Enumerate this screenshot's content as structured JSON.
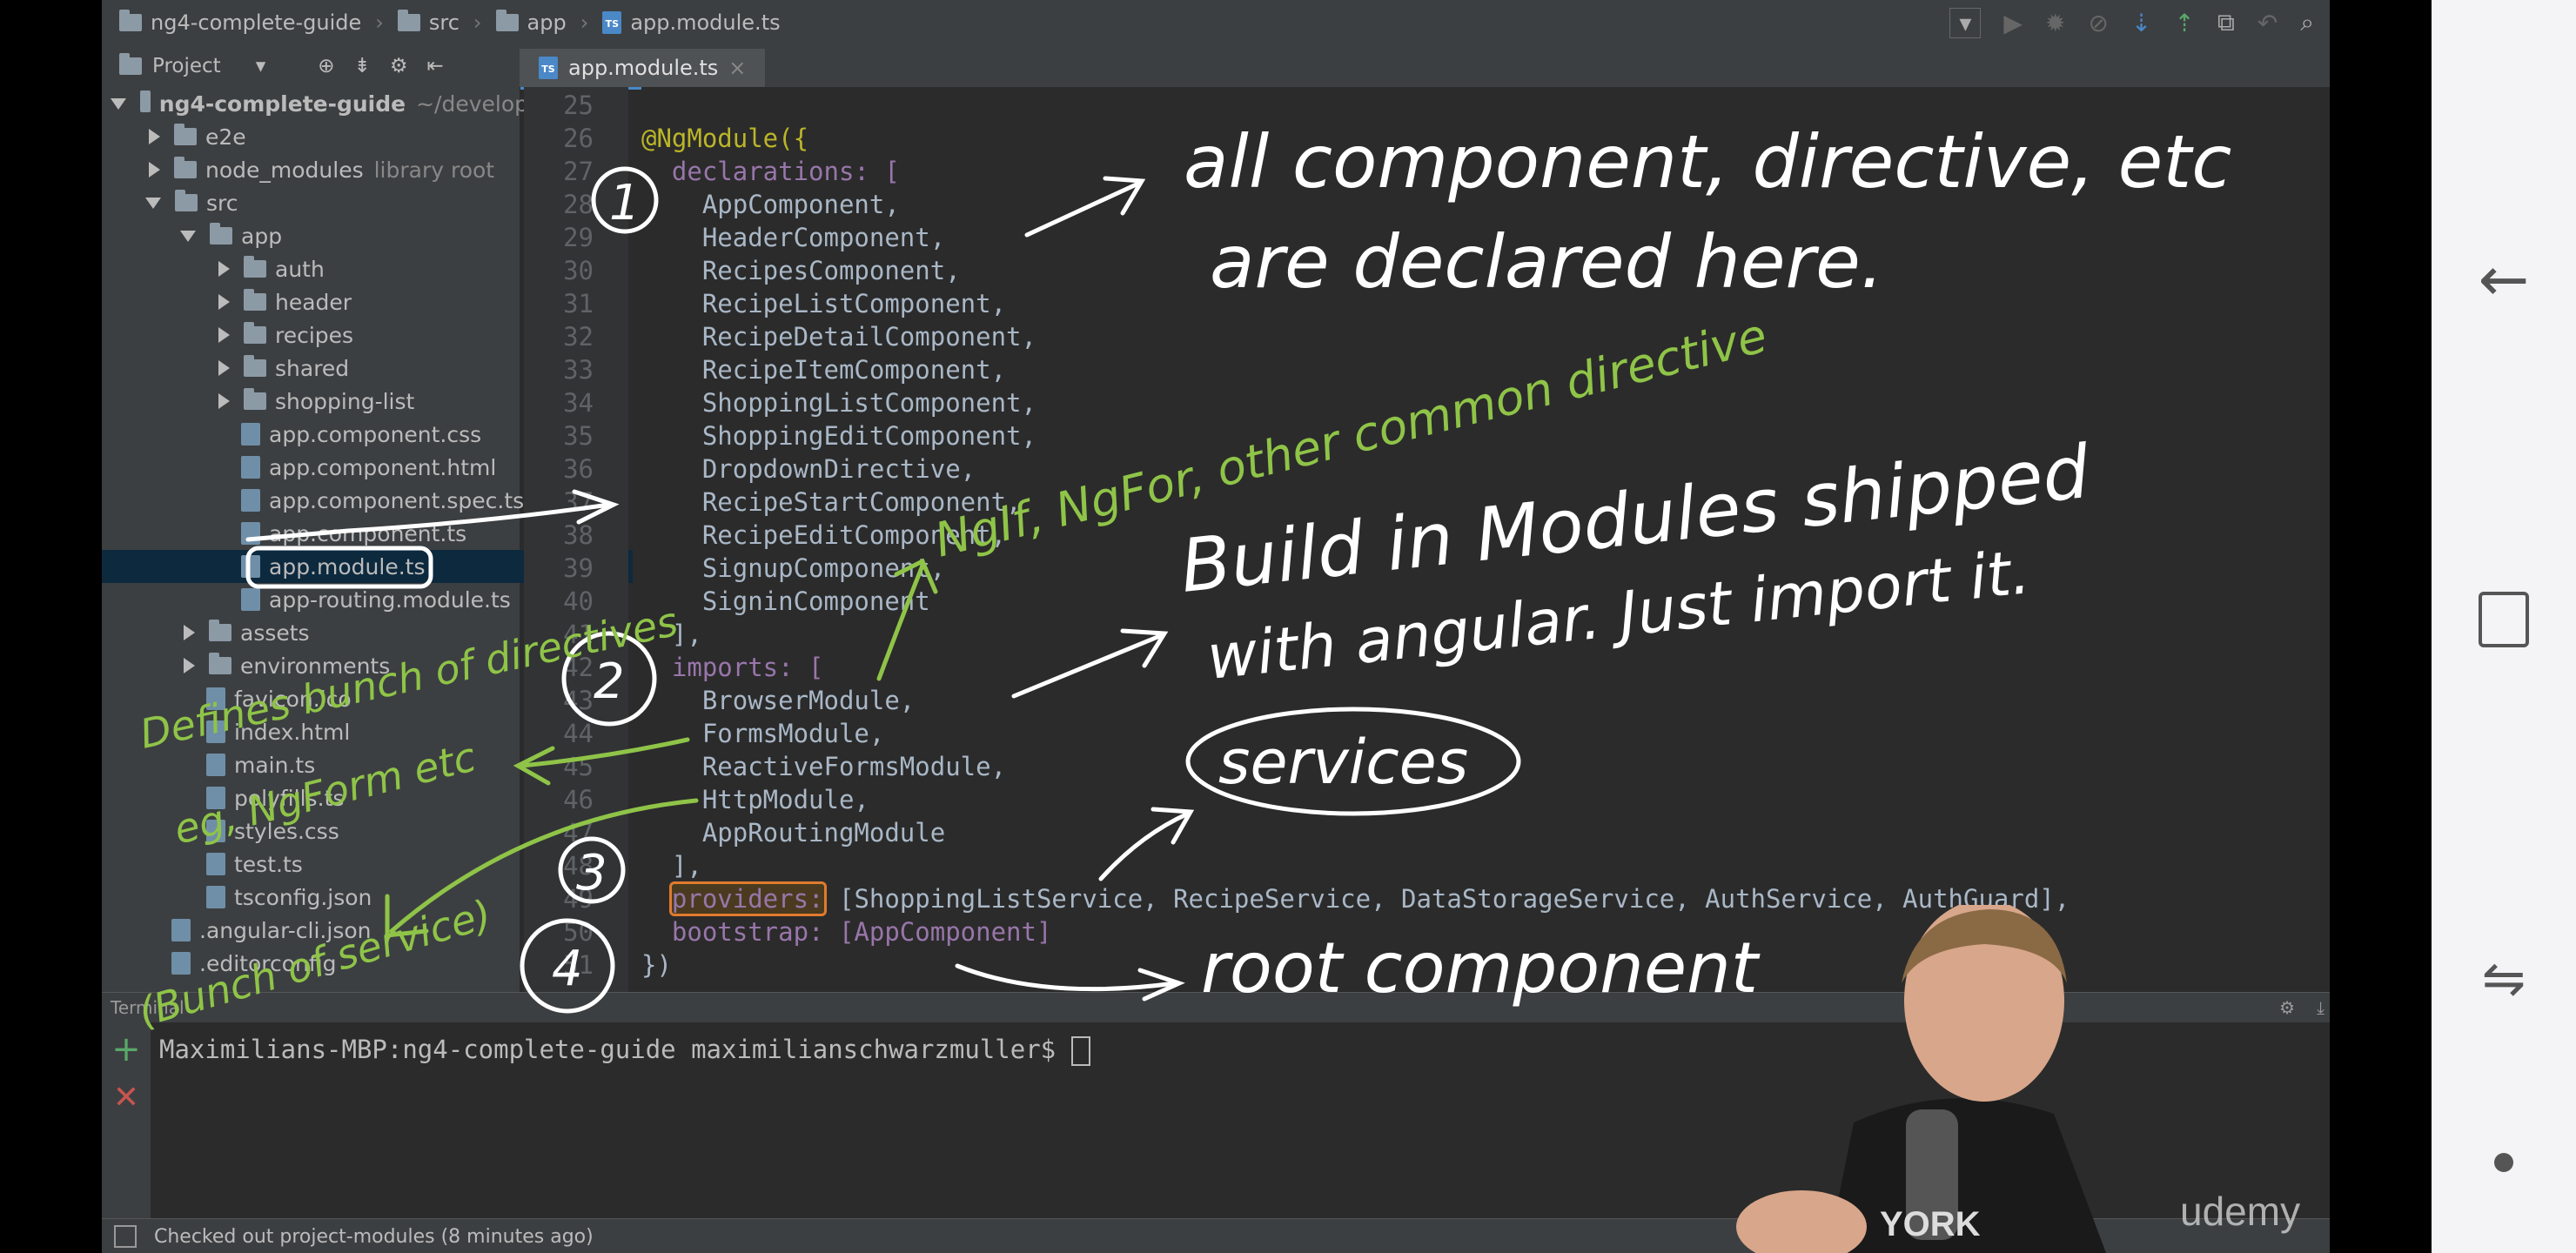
{
  "breadcrumb": [
    "ng4-complete-guide",
    "src",
    "app",
    "app.module.ts"
  ],
  "project_label": "Project",
  "editor_tab": "app.module.ts",
  "tree": [
    {
      "label": "ng4-complete-guide",
      "extra": "~/develop",
      "level": 0,
      "arrow": "open",
      "kind": "folder"
    },
    {
      "label": "e2e",
      "extra": "",
      "level": 1,
      "arrow": "closed",
      "kind": "folder"
    },
    {
      "label": "node_modules",
      "extra": "library root",
      "level": 1,
      "arrow": "closed",
      "kind": "folder"
    },
    {
      "label": "src",
      "extra": "",
      "level": 1,
      "arrow": "open",
      "kind": "folder"
    },
    {
      "label": "app",
      "extra": "",
      "level": 2,
      "arrow": "open",
      "kind": "folder"
    },
    {
      "label": "auth",
      "extra": "",
      "level": 3,
      "arrow": "closed",
      "kind": "folder"
    },
    {
      "label": "header",
      "extra": "",
      "level": 3,
      "arrow": "closed",
      "kind": "folder"
    },
    {
      "label": "recipes",
      "extra": "",
      "level": 3,
      "arrow": "closed",
      "kind": "folder"
    },
    {
      "label": "shared",
      "extra": "",
      "level": 3,
      "arrow": "closed",
      "kind": "folder"
    },
    {
      "label": "shopping-list",
      "extra": "",
      "level": 3,
      "arrow": "closed",
      "kind": "folder"
    },
    {
      "label": "app.component.css",
      "extra": "",
      "level": 3,
      "arrow": "",
      "kind": "file"
    },
    {
      "label": "app.component.html",
      "extra": "",
      "level": 3,
      "arrow": "",
      "kind": "file"
    },
    {
      "label": "app.component.spec.ts",
      "extra": "",
      "level": 3,
      "arrow": "",
      "kind": "file"
    },
    {
      "label": "app.component.ts",
      "extra": "",
      "level": 3,
      "arrow": "",
      "kind": "file"
    },
    {
      "label": "app.module.ts",
      "extra": "",
      "level": 3,
      "arrow": "",
      "kind": "file",
      "selected": true
    },
    {
      "label": "app-routing.module.ts",
      "extra": "",
      "level": 3,
      "arrow": "",
      "kind": "file"
    },
    {
      "label": "assets",
      "extra": "",
      "level": 2,
      "arrow": "closed",
      "kind": "folder"
    },
    {
      "label": "environments",
      "extra": "",
      "level": 2,
      "arrow": "closed",
      "kind": "folder"
    },
    {
      "label": "favicon.ico",
      "extra": "",
      "level": 2,
      "arrow": "",
      "kind": "file"
    },
    {
      "label": "index.html",
      "extra": "",
      "level": 2,
      "arrow": "",
      "kind": "file"
    },
    {
      "label": "main.ts",
      "extra": "",
      "level": 2,
      "arrow": "",
      "kind": "file"
    },
    {
      "label": "polyfills.ts",
      "extra": "",
      "level": 2,
      "arrow": "",
      "kind": "file"
    },
    {
      "label": "styles.css",
      "extra": "",
      "level": 2,
      "arrow": "",
      "kind": "file"
    },
    {
      "label": "test.ts",
      "extra": "",
      "level": 2,
      "arrow": "",
      "kind": "file"
    },
    {
      "label": "tsconfig.json",
      "extra": "",
      "level": 2,
      "arrow": "",
      "kind": "file"
    },
    {
      "label": ".angular-cli.json",
      "extra": "",
      "level": 1,
      "arrow": "",
      "kind": "file"
    },
    {
      "label": ".editorconfig",
      "extra": "",
      "level": 1,
      "arrow": "",
      "kind": "file"
    }
  ],
  "code_lines": [
    {
      "n": "25",
      "text": ""
    },
    {
      "n": "26",
      "text": "@NgModule({"
    },
    {
      "n": "27",
      "text": "  declarations: ["
    },
    {
      "n": "28",
      "text": "    AppComponent,"
    },
    {
      "n": "29",
      "text": "    HeaderComponent,"
    },
    {
      "n": "30",
      "text": "    RecipesComponent,"
    },
    {
      "n": "31",
      "text": "    RecipeListComponent,"
    },
    {
      "n": "32",
      "text": "    RecipeDetailComponent,"
    },
    {
      "n": "33",
      "text": "    RecipeItemComponent,"
    },
    {
      "n": "34",
      "text": "    ShoppingListComponent,"
    },
    {
      "n": "35",
      "text": "    ShoppingEditComponent,"
    },
    {
      "n": "36",
      "text": "    DropdownDirective,"
    },
    {
      "n": "37",
      "text": "    RecipeStartComponent,"
    },
    {
      "n": "38",
      "text": "    RecipeEditComponent,"
    },
    {
      "n": "39",
      "text": "    SignupComponent,"
    },
    {
      "n": "40",
      "text": "    SigninComponent"
    },
    {
      "n": "41",
      "text": "  ],"
    },
    {
      "n": "42",
      "text": "  imports: ["
    },
    {
      "n": "43",
      "text": "    BrowserModule,"
    },
    {
      "n": "44",
      "text": "    FormsModule,"
    },
    {
      "n": "45",
      "text": "    ReactiveFormsModule,"
    },
    {
      "n": "46",
      "text": "    HttpModule,"
    },
    {
      "n": "47",
      "text": "    AppRoutingModule"
    },
    {
      "n": "48",
      "text": "  ],"
    },
    {
      "n": "49",
      "text": "  providers: [ShoppingListService, RecipeService, DataStorageService, AuthService, AuthGuard],"
    },
    {
      "n": "50",
      "text": "  bootstrap: [AppComponent]"
    },
    {
      "n": "51",
      "text": "})"
    }
  ],
  "terminal": {
    "label": "Terminal",
    "prompt": "Maximilians-MBP:ng4-complete-guide maximilianschwarzmuller$ "
  },
  "status": "Checked out project-modules (8 minutes ago)",
  "watermark": "udemy",
  "annotations": {
    "note1": "all component, directive, etc",
    "note1b": "are declared here.",
    "note_green1": "NgIf, NgFor, other common directive",
    "note2": "Build in Modules shipped",
    "note2b": "with angular. Just import it.",
    "note_services": "services",
    "note_root": "root component",
    "note_green2": "Defines bunch of directives",
    "note_green3": "eg, NgForm etc",
    "note_green4": "(Bunch of service)",
    "num1": "1",
    "num2": "2",
    "num3": "3",
    "num4": "4"
  },
  "colors": {
    "editor_bg": "#2b2b2b",
    "panel_bg": "#3c3f41",
    "ink_white": "#ffffff",
    "ink_green": "#8fc448",
    "highlight": "#e07b2d"
  }
}
